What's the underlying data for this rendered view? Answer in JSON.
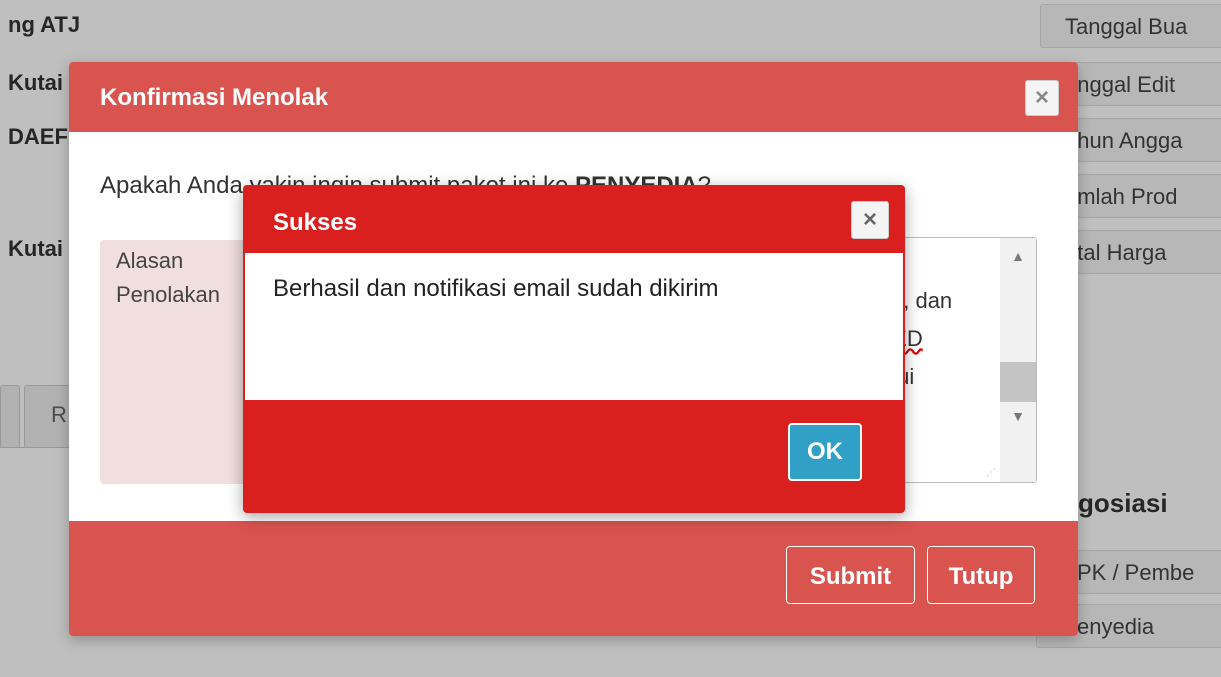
{
  "background": {
    "left_labels": [
      "ng ATJ",
      "Kutai",
      "DAEF",
      "Kutai"
    ],
    "right_fields": [
      "Tanggal Bua",
      "anggal Edit",
      "ahun Angga",
      "umlah Prod",
      "otal Harga"
    ],
    "tab_fragment": "R",
    "section_heading": "gosiasi",
    "right_lower_fields": [
      "PK / Pembe",
      "enyedia"
    ]
  },
  "confirm_modal": {
    "title": "Konfirmasi Menolak",
    "question_prefix": "Apakah Anda yakin ingin submit paket ini ke ",
    "question_bold": "PENYEDIA",
    "question_suffix": "?",
    "label_line1": "Alasan",
    "label_line2": "Penolakan",
    "textarea_frag1": "ak, dan",
    "textarea_frag2": "LED",
    "textarea_frag3": "alui",
    "submit_label": "Submit",
    "close_label": "Tutup"
  },
  "success_modal": {
    "title": "Sukses",
    "message": "Berhasil dan notifikasi email sudah dikirim",
    "ok_label": "OK"
  },
  "icons": {
    "close": "×",
    "scroll_up": "▲",
    "scroll_down": "▼",
    "resize": "⋰"
  },
  "colors": {
    "danger": "#d9534f",
    "danger_strong": "#d9201f",
    "info": "#31a0c6"
  }
}
